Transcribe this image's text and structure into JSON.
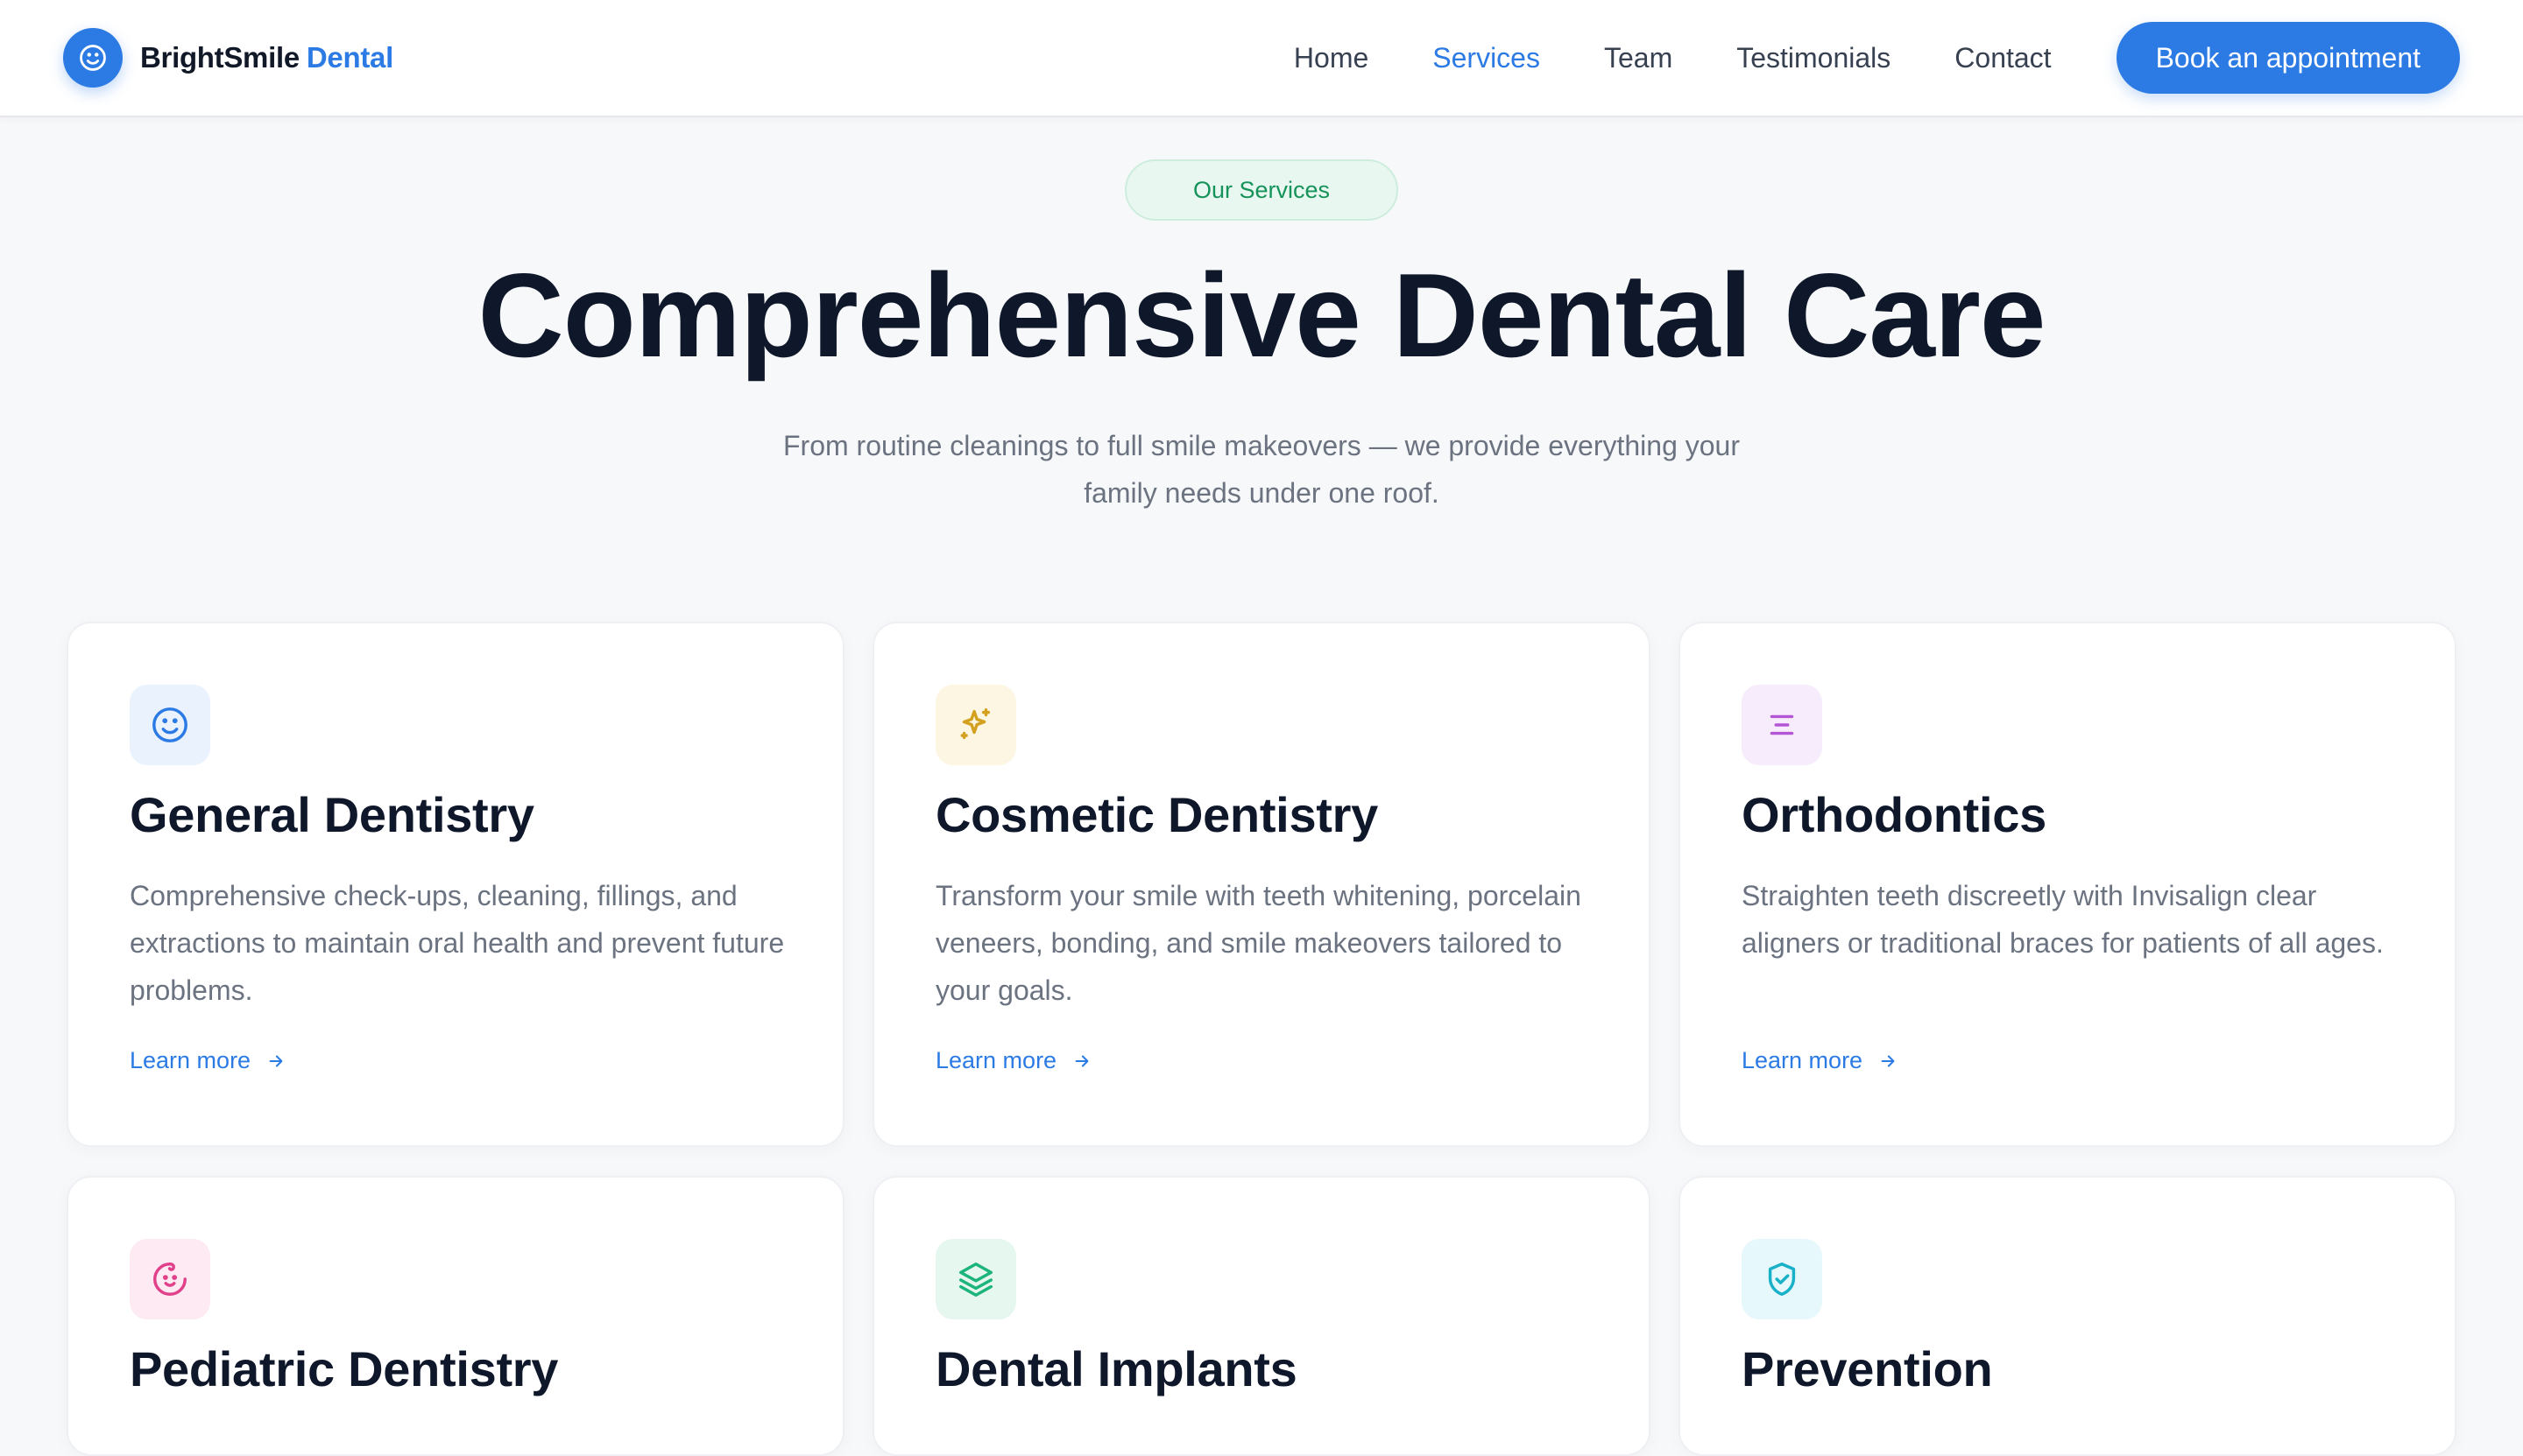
{
  "brand": {
    "name": "BrightSmile",
    "accent": "Dental",
    "logo_icon": "smile-icon"
  },
  "nav": {
    "items": [
      {
        "label": "Home",
        "active": false
      },
      {
        "label": "Services",
        "active": true
      },
      {
        "label": "Team",
        "active": false
      },
      {
        "label": "Testimonials",
        "active": false
      },
      {
        "label": "Contact",
        "active": false
      }
    ],
    "cta": "Book an appointment"
  },
  "hero": {
    "badge": "Our Services",
    "title": "Comprehensive Dental Care",
    "subtitle": "From routine cleanings to full smile makeovers — we provide everything your family needs under one roof."
  },
  "services": [
    {
      "title": "General Dentistry",
      "description": "Comprehensive check-ups, cleaning, fillings, and extractions to maintain oral health and prevent future problems.",
      "link": "Learn more",
      "icon": "smile-icon",
      "color": "#2c7be5"
    },
    {
      "title": "Cosmetic Dentistry",
      "description": "Transform your smile with teeth whitening, porcelain veneers, bonding, and smile makeovers tailored to your goals.",
      "link": "Learn more",
      "icon": "sparkles-icon",
      "color": "#d4a01f"
    },
    {
      "title": "Orthodontics",
      "description": "Straighten teeth discreetly with Invisalign clear aligners or traditional braces for patients of all ages.",
      "link": "Learn more",
      "icon": "align-center-icon",
      "color": "#b455d6"
    },
    {
      "title": "Pediatric Dentistry",
      "icon": "baby-icon",
      "color": "#e0418a"
    },
    {
      "title": "Dental Implants",
      "icon": "layers-icon",
      "color": "#1bb47a"
    },
    {
      "title": "Prevention",
      "icon": "shield-check-icon",
      "color": "#18b1c8"
    }
  ],
  "colors": {
    "primary": "#2c7be5",
    "badge_bg": "#e8f7ef",
    "badge_text": "#15935a",
    "page_bg": "#f7f8fa"
  }
}
